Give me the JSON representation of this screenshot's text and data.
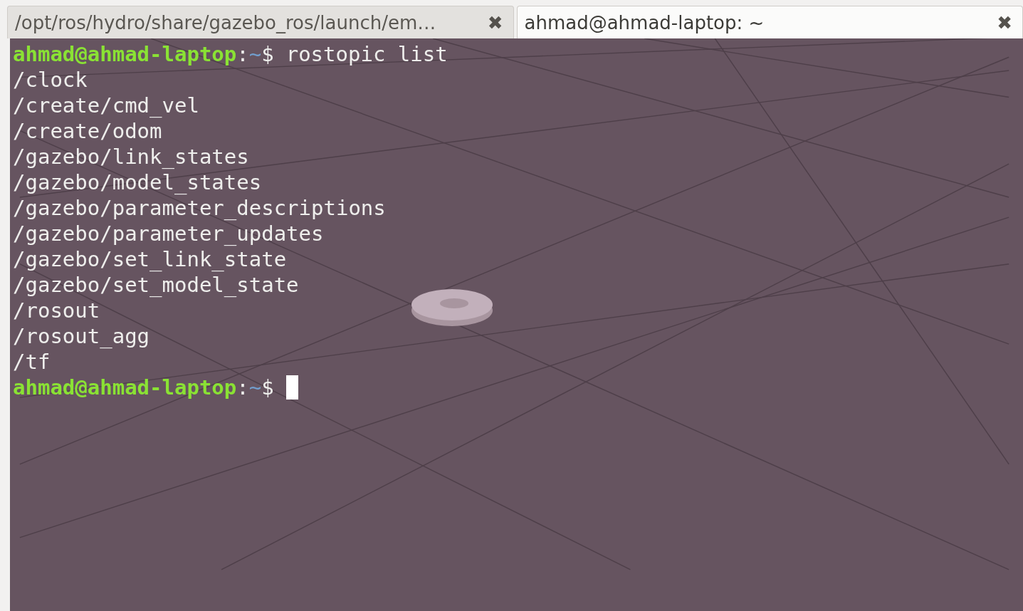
{
  "tabs": [
    {
      "title": "/opt/ros/hydro/share/gazebo_ros/launch/em…",
      "close": "✖",
      "selected": false
    },
    {
      "title": "ahmad@ahmad-laptop: ~",
      "close": "✖",
      "selected": true
    }
  ],
  "terminal": {
    "lines": [
      {
        "kind": "prompt",
        "user_host": "ahmad@ahmad-laptop",
        "separator": ":",
        "path": "~",
        "symbol": "$",
        "command": "rostopic list",
        "cursor": false
      },
      {
        "kind": "output",
        "text": "/clock"
      },
      {
        "kind": "output",
        "text": "/create/cmd_vel"
      },
      {
        "kind": "output",
        "text": "/create/odom"
      },
      {
        "kind": "output",
        "text": "/gazebo/link_states"
      },
      {
        "kind": "output",
        "text": "/gazebo/model_states"
      },
      {
        "kind": "output",
        "text": "/gazebo/parameter_descriptions"
      },
      {
        "kind": "output",
        "text": "/gazebo/parameter_updates"
      },
      {
        "kind": "output",
        "text": "/gazebo/set_link_state"
      },
      {
        "kind": "output",
        "text": "/gazebo/set_model_state"
      },
      {
        "kind": "output",
        "text": "/rosout"
      },
      {
        "kind": "output",
        "text": "/rosout_agg"
      },
      {
        "kind": "output",
        "text": "/tf"
      },
      {
        "kind": "prompt",
        "user_host": "ahmad@ahmad-laptop",
        "separator": ":",
        "path": "~",
        "symbol": "$",
        "cursor": true
      }
    ]
  }
}
